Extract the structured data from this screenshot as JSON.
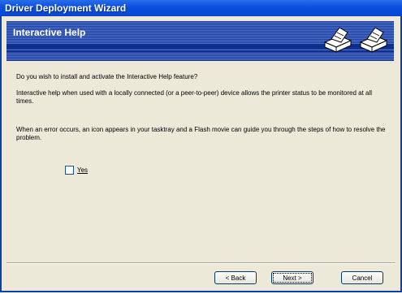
{
  "window": {
    "title": "Driver Deployment Wizard"
  },
  "banner": {
    "title": "Interactive Help",
    "icons": [
      "printer-icon",
      "printer-icon"
    ]
  },
  "content": {
    "question": "Do you wish to install and activate the Interactive Help feature?",
    "para1": "Interactive help when used with a locally connected (or a peer-to-peer) device allows the printer status to be monitored at all times.",
    "para2": "When an error occurs, an icon appears in your tasktray and a Flash movie can guide you through the steps of how to resolve the problem.",
    "checkbox": {
      "label": "Yes",
      "checked": false
    }
  },
  "buttons": {
    "back": "< Back",
    "next": "Next >",
    "cancel": "Cancel"
  },
  "colors": {
    "titlebar": "#0a4ee0",
    "banner": "#1b3fa0",
    "face": "#ece9d8"
  }
}
